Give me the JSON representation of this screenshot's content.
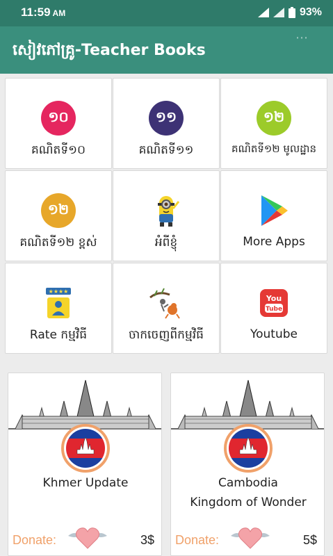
{
  "status_bar": {
    "time": "11:59",
    "ampm": "AM",
    "battery": "93%"
  },
  "app_bar": {
    "title": "សៀវភៅគ្រូ-Teacher Books"
  },
  "grid": [
    {
      "label": "គណិតទី១០",
      "icon": "numeral-10-icon",
      "glyph": "១០",
      "color": "#e5265f"
    },
    {
      "label": "គណិតទី១១",
      "icon": "numeral-11-icon",
      "glyph": "១១",
      "color": "#3d3275"
    },
    {
      "label": "គណិតទី១២ មូលដ្ឋាន",
      "icon": "numeral-12-basic-icon",
      "glyph": "១២",
      "color": "#9ccb2a"
    },
    {
      "label": "គណិតទី១២ ខ្ពស់",
      "icon": "numeral-12-advanced-icon",
      "glyph": "១២",
      "color": "#e7a72a"
    },
    {
      "label": "អំពីខ្ញុំ",
      "icon": "minion-icon"
    },
    {
      "label": "More Apps",
      "icon": "play-store-icon"
    },
    {
      "label": "Rate កម្មវិធី",
      "icon": "rate-stars-icon"
    },
    {
      "label": "ចាកចេញពីកម្មវិធី",
      "icon": "exit-cartoon-icon"
    },
    {
      "label": "Youtube",
      "icon": "youtube-icon"
    }
  ],
  "cards": [
    {
      "title_line1": "Khmer Update",
      "title_line2": "",
      "donate": "Donate:",
      "price": "3$"
    },
    {
      "title_line1": "Cambodia",
      "title_line2": "Kingdom of Wonder",
      "donate": "Donate:",
      "price": "5$"
    }
  ]
}
